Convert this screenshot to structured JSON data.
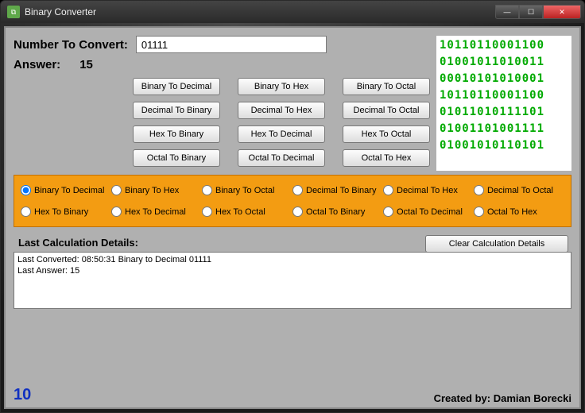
{
  "window": {
    "title": "Binary Converter"
  },
  "labels": {
    "numberToConvert": "Number To Convert:",
    "answer": "Answer:",
    "lastCalcTitle": "Last Calculation Details:",
    "clearBtn": "Clear Calculation Details",
    "createdBy": "Created by: Damian Borecki"
  },
  "input": {
    "value": "01111"
  },
  "answer": "15",
  "buttons": [
    [
      "Binary To Decimal",
      "Binary To Hex",
      "Binary To Octal"
    ],
    [
      "Decimal To Binary",
      "Decimal To Hex",
      "Decimal To Octal"
    ],
    [
      "Hex To Binary",
      "Hex To Decimal",
      "Hex To Octal"
    ],
    [
      "Octal To Binary",
      "Octal To Decimal",
      "Octal To Hex"
    ]
  ],
  "radios": {
    "row1": [
      "Binary To Decimal",
      "Binary To Hex",
      "Binary To Octal",
      "Decimal To Binary",
      "Decimal To Hex",
      "Decimal To Octal"
    ],
    "row2": [
      "Hex To Binary",
      "Hex To Decimal",
      "Hex To Octal",
      "Octal To Binary",
      "Octal To Decimal",
      "Octal To Hex"
    ],
    "selected": "Binary To Decimal"
  },
  "details": {
    "line1": "Last Converted: 08:50:31  Binary to Decimal 01111",
    "line2": "Last Answer: 15"
  },
  "binaryArt": "10110110001100\n01001011010011\n00010101010001\n10110110001100\n01011010111101\n01001101001111\n01001010110101",
  "footerNum": "10"
}
